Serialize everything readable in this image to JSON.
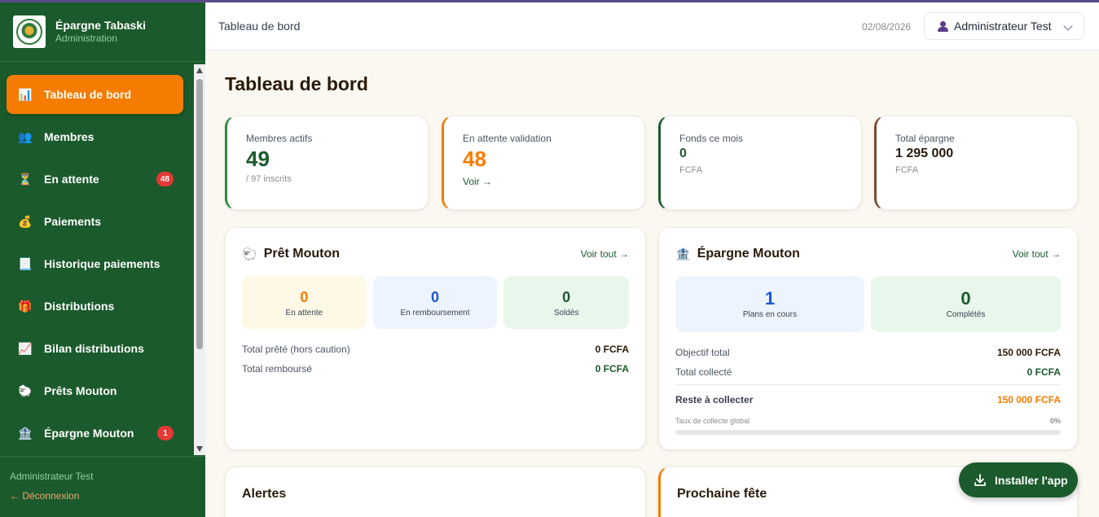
{
  "brand": {
    "title": "Épargne Tabaski",
    "subtitle": "Administration",
    "logo_text": "PA JC"
  },
  "sidebar": {
    "items": [
      {
        "label": "Tableau de bord",
        "icon": "chart-icon",
        "glyph": "📊",
        "active": true
      },
      {
        "label": "Membres",
        "icon": "members-icon",
        "glyph": "👥"
      },
      {
        "label": "En attente",
        "icon": "hourglass-icon",
        "glyph": "⏳",
        "badge": "48"
      },
      {
        "label": "Paiements",
        "icon": "money-bag-icon",
        "glyph": "💰"
      },
      {
        "label": "Historique paiements",
        "icon": "receipt-icon",
        "glyph": "📃"
      },
      {
        "label": "Distributions",
        "icon": "gift-icon",
        "glyph": "🎁"
      },
      {
        "label": "Bilan distributions",
        "icon": "trend-icon",
        "glyph": "📈"
      },
      {
        "label": "Prêts Mouton",
        "icon": "sheep-icon",
        "glyph": "🐑"
      },
      {
        "label": "Épargne Mouton",
        "icon": "bank-icon",
        "glyph": "🏦",
        "badge": "1"
      }
    ],
    "footer_user": "Administrateur Test",
    "logout": "← Déconnexion"
  },
  "topbar": {
    "title": "Tableau de bord",
    "date": "02/08/2026",
    "user": "Administrateur Test"
  },
  "page_title": "Tableau de bord",
  "stats": [
    {
      "label": "Membres actifs",
      "value": "49",
      "sub": "/ 97 inscrits",
      "color": "#1b5a2c"
    },
    {
      "label": "En attente validation",
      "value": "48",
      "link": "Voir →",
      "color": "#f57c00"
    },
    {
      "label": "Fonds ce mois",
      "value": "0",
      "sub": "FCFA",
      "color": "#1b5a2c"
    },
    {
      "label": "Total épargne",
      "value": "1 295 000",
      "sub": "FCFA",
      "color": "#2a1a0a"
    }
  ],
  "pret": {
    "title": "Prêt Mouton",
    "voir": "Voir tout →",
    "tiles": [
      {
        "value": "0",
        "label": "En attente",
        "color": "#f57c00",
        "bg": "#fff8e6"
      },
      {
        "value": "0",
        "label": "En remboursement",
        "color": "#1a56db",
        "bg": "#eef4ff"
      },
      {
        "value": "0",
        "label": "Soldés",
        "color": "#1b5a2c",
        "bg": "#e9f6ec"
      }
    ],
    "rows": [
      {
        "label": "Total prêté (hors caution)",
        "value": "0 FCFA",
        "color": "#2a1a0a"
      },
      {
        "label": "Total remboursé",
        "value": "0 FCFA",
        "color": "#1b5a2c"
      }
    ]
  },
  "epargne": {
    "title": "Épargne Mouton",
    "voir": "Voir tout →",
    "tiles": [
      {
        "value": "1",
        "label": "Plans en cours",
        "color": "#1a56db",
        "bg": "#eef4ff"
      },
      {
        "value": "0",
        "label": "Complétés",
        "color": "#1b5a2c",
        "bg": "#e9f6ec"
      }
    ],
    "rows": [
      {
        "label": "Objectif total",
        "value": "150 000 FCFA",
        "color": "#2a1a0a"
      },
      {
        "label": "Total collecté",
        "value": "0 FCFA",
        "color": "#1b5a2c"
      }
    ],
    "reste_label": "Reste à collecter",
    "reste_value": "150 000 FCFA",
    "taux_label": "Taux de collecte global",
    "taux_value": "0%",
    "taux_fraction": 0
  },
  "alertes": {
    "title": "Alertes"
  },
  "fete": {
    "title": "Prochaine fête"
  },
  "install": {
    "label": "Installer l'app"
  }
}
